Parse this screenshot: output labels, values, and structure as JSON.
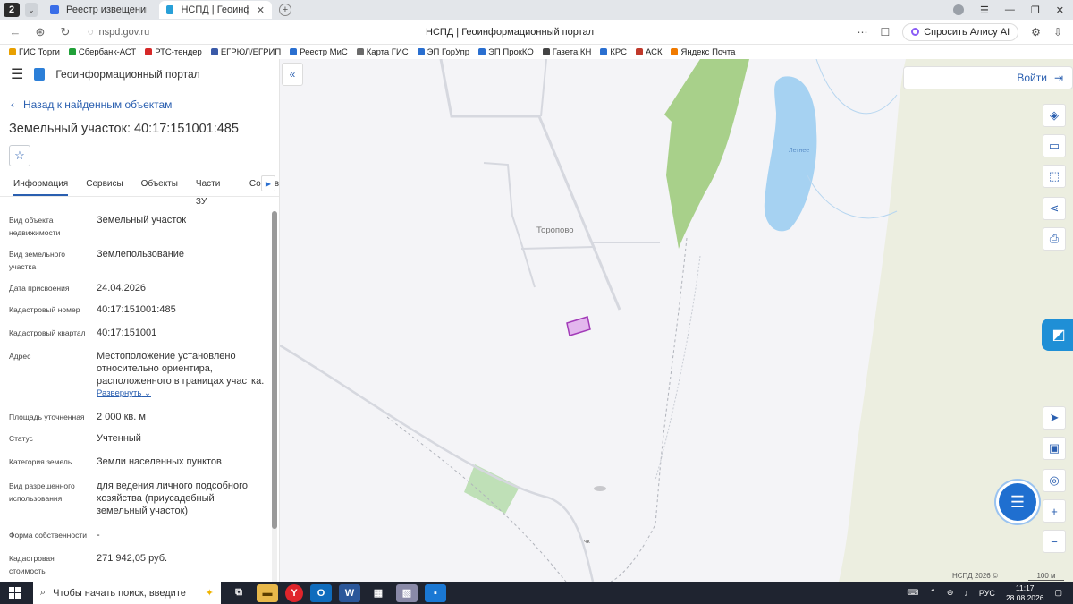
{
  "browser": {
    "tab_count": "2",
    "tabs": [
      {
        "title": "Реестр извещений",
        "active": false
      },
      {
        "title": "НСПД | Геоинформационный портал",
        "active": true
      }
    ],
    "url": "nspd.gov.ru",
    "page_title": "НСПД | Геоинформационный портал",
    "alice_label": "Спросить Алису AI"
  },
  "bookmarks": [
    {
      "label": "ГИС Торги",
      "color": "#e8a000"
    },
    {
      "label": "Сбербанк-АСТ",
      "color": "#21a038"
    },
    {
      "label": "РТС-тендер",
      "color": "#d62828"
    },
    {
      "label": "ЕГРЮЛ/ЕГРИП",
      "color": "#3a5aa8"
    },
    {
      "label": "Реестр МиС",
      "color": "#2a6fd0"
    },
    {
      "label": "Карта ГИС",
      "color": "#6b6b6b"
    },
    {
      "label": "ЭП ГорУпр",
      "color": "#2a6fd0"
    },
    {
      "label": "ЭП ПрокКО",
      "color": "#2a6fd0"
    },
    {
      "label": "Газета КН",
      "color": "#444444"
    },
    {
      "label": "КРС",
      "color": "#2a6fd0"
    },
    {
      "label": "АСК",
      "color": "#c0392b"
    },
    {
      "label": "Яндекс Почта",
      "color": "#f07a00"
    }
  ],
  "portal": {
    "name": "Геоинформационный портал",
    "back_label": "Назад к найденным объектам",
    "object_title": "Земельный участок: 40:17:151001:485",
    "tabs": [
      "Информация",
      "Сервисы",
      "Объекты",
      "Части ЗУ",
      "Состав"
    ],
    "properties": [
      {
        "label": "Вид объекта недвижимости",
        "value": "Земельный участок"
      },
      {
        "label": "Вид земельного участка",
        "value": "Землепользование"
      },
      {
        "label": "Дата присвоения",
        "value": "24.04.2026"
      },
      {
        "label": "Кадастровый номер",
        "value": "40:17:151001:485"
      },
      {
        "label": "Кадастровый квартал",
        "value": "40:17:151001"
      },
      {
        "label": "Адрес",
        "value": "Местоположение установлено относительно ориентира, расположенного в границах участка.",
        "link": "Развернуть"
      },
      {
        "label": "Площадь уточненная",
        "value": "2 000 кв. м"
      },
      {
        "label": "Статус",
        "value": "Учтенный"
      },
      {
        "label": "Категория земель",
        "value": "Земли населенных пунктов"
      },
      {
        "label": "Вид разрешенного использования",
        "value": "для ведения личного подсобного хозяйства (приусадебный земельный участок)"
      },
      {
        "label": "Форма собственности",
        "value": "-"
      },
      {
        "label": "Кадастровая стоимость",
        "value": "271 942,05 руб."
      }
    ]
  },
  "map": {
    "login_label": "Войти",
    "village_label": "Торопово",
    "lake_label": "Летнее",
    "ch_label": "чк",
    "copyright": "НСПД 2026 ©",
    "scale_label": "100 м",
    "tools": [
      "layers-icon",
      "ruler-icon",
      "select-area-icon",
      "share-icon",
      "print-icon"
    ],
    "bottom_tools": [
      "navigate-icon",
      "minimap-icon",
      "location-icon",
      "zoom-in-icon",
      "zoom-out-icon"
    ]
  },
  "taskbar": {
    "search_placeholder": "Чтобы начать поиск, введите",
    "language": "РУС",
    "time": "11:17",
    "date": "28.08.2026"
  }
}
